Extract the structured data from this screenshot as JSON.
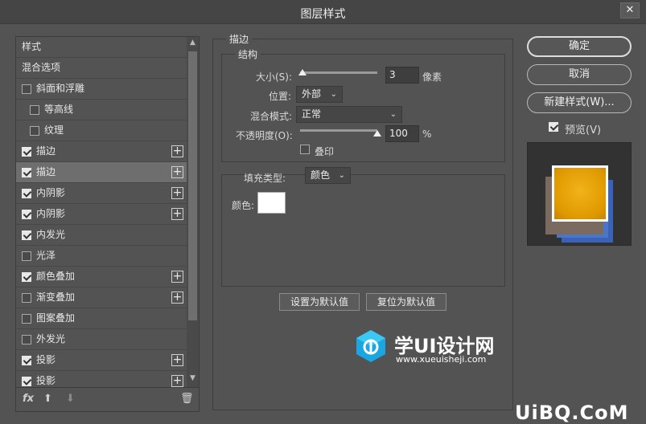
{
  "window": {
    "title": "图层样式",
    "close_label": "✕"
  },
  "style_list": {
    "items": [
      {
        "label": "样式",
        "checkbox": false,
        "checked": false,
        "plus": false,
        "indent": 0
      },
      {
        "label": "混合选项",
        "checkbox": false,
        "checked": false,
        "plus": false,
        "indent": 0
      },
      {
        "label": "斜面和浮雕",
        "checkbox": true,
        "checked": false,
        "plus": false,
        "indent": 0
      },
      {
        "label": "等高线",
        "checkbox": true,
        "checked": false,
        "plus": false,
        "indent": 1
      },
      {
        "label": "纹理",
        "checkbox": true,
        "checked": false,
        "plus": false,
        "indent": 1
      },
      {
        "label": "描边",
        "checkbox": true,
        "checked": true,
        "plus": true,
        "indent": 0
      },
      {
        "label": "描边",
        "checkbox": true,
        "checked": true,
        "plus": true,
        "indent": 0,
        "selected": true
      },
      {
        "label": "内阴影",
        "checkbox": true,
        "checked": true,
        "plus": true,
        "indent": 0
      },
      {
        "label": "内阴影",
        "checkbox": true,
        "checked": true,
        "plus": true,
        "indent": 0
      },
      {
        "label": "内发光",
        "checkbox": true,
        "checked": true,
        "plus": false,
        "indent": 0
      },
      {
        "label": "光泽",
        "checkbox": true,
        "checked": false,
        "plus": false,
        "indent": 0
      },
      {
        "label": "颜色叠加",
        "checkbox": true,
        "checked": true,
        "plus": true,
        "indent": 0
      },
      {
        "label": "渐变叠加",
        "checkbox": true,
        "checked": false,
        "plus": true,
        "indent": 0
      },
      {
        "label": "图案叠加",
        "checkbox": true,
        "checked": false,
        "plus": false,
        "indent": 0
      },
      {
        "label": "外发光",
        "checkbox": true,
        "checked": false,
        "plus": false,
        "indent": 0
      },
      {
        "label": "投影",
        "checkbox": true,
        "checked": true,
        "plus": true,
        "indent": 0
      },
      {
        "label": "投影",
        "checkbox": true,
        "checked": true,
        "plus": true,
        "indent": 0
      }
    ],
    "plus_glyph": "+",
    "bottom": {
      "fx": "fx",
      "up": "⬆",
      "down": "⬇",
      "trash": "🗑"
    }
  },
  "stroke": {
    "group_title": "描边",
    "structure_title": "结构",
    "size_label": "大小(S):",
    "size_value": "3",
    "size_unit": "像素",
    "size_slider_fraction": 0.03,
    "position_label": "位置:",
    "position_value": "外部",
    "blend_label": "混合模式:",
    "blend_value": "正常",
    "opacity_label": "不透明度(O):",
    "opacity_value": "100",
    "opacity_unit": "%",
    "opacity_slider_fraction": 1.0,
    "overprint_label": "叠印",
    "overprint_checked": false,
    "fill_type_label": "填充类型:",
    "fill_type_value": "颜色",
    "color_label": "颜色:",
    "color_value": "#ffffff",
    "set_default_label": "设置为默认值",
    "reset_default_label": "复位为默认值"
  },
  "actions": {
    "ok": "确定",
    "cancel": "取消",
    "new_style": "新建样式(W)...",
    "preview_label": "预览(V)",
    "preview_checked": true
  },
  "watermark": {
    "title": "学UI设计网",
    "url": "www.xueuisheji.com",
    "corner": "UiBQ.CoM"
  },
  "colors": {
    "bg": "#535353",
    "title_bar": "#454545",
    "selected_row": "#6e6e6e",
    "preview_gold": "#e0a000",
    "preview_blue": "#3a63b8",
    "preview_tan": "#7a6a60"
  }
}
